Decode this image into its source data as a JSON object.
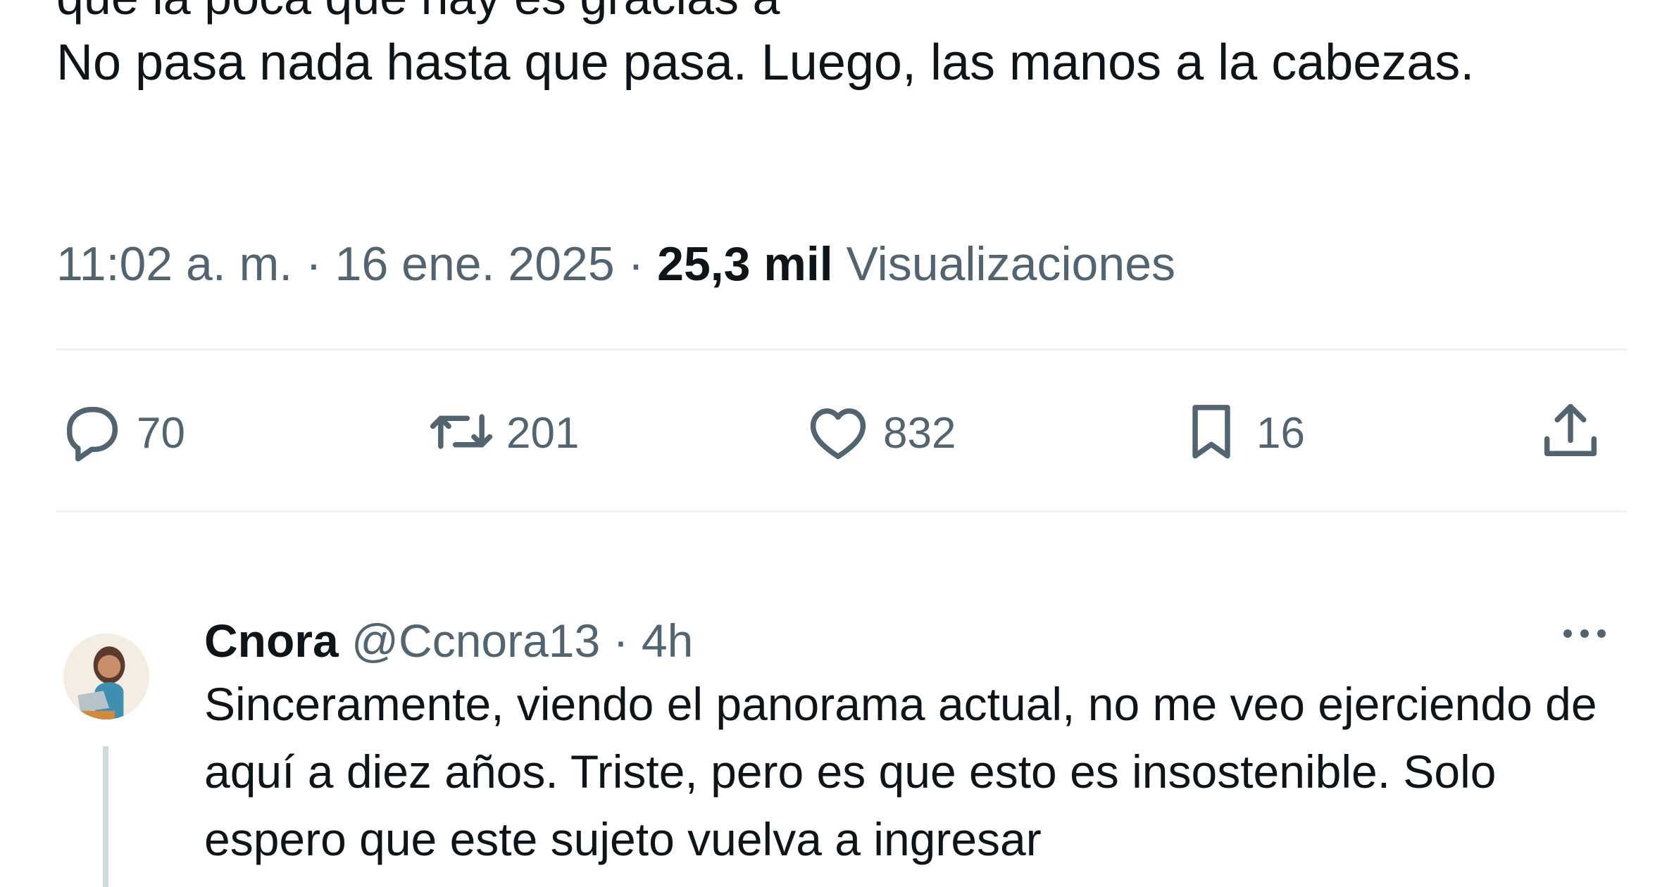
{
  "tweet": {
    "partial_top_line": "que la poca que hay es gracias a",
    "text": "No pasa nada hasta que pasa. Luego, las manos a la cabezas.",
    "time": "11:02 a. m.",
    "date": "16 ene. 2025",
    "views_count": "25,3 mil",
    "views_label": "Visualizaciones",
    "separator": "·"
  },
  "actions": {
    "replies": "70",
    "retweets": "201",
    "likes": "832",
    "bookmarks": "16"
  },
  "icons": [
    "reply-icon",
    "retweet-icon",
    "like-icon",
    "bookmark-icon",
    "share-icon",
    "more-icon"
  ],
  "colors": {
    "text": "#0f1419",
    "secondary": "#536471",
    "divider": "#eff3f4",
    "thread_line": "#cfd9de"
  },
  "reply": {
    "name": "Cnora",
    "handle": "@Ccnora13",
    "separator": "·",
    "time": "4h",
    "text": "Sinceramente, viendo el panorama actual, no me veo ejerciendo de aquí a diez años. Triste, pero es que esto es insostenible. Solo espero que este sujeto vuelva a ingresar"
  }
}
